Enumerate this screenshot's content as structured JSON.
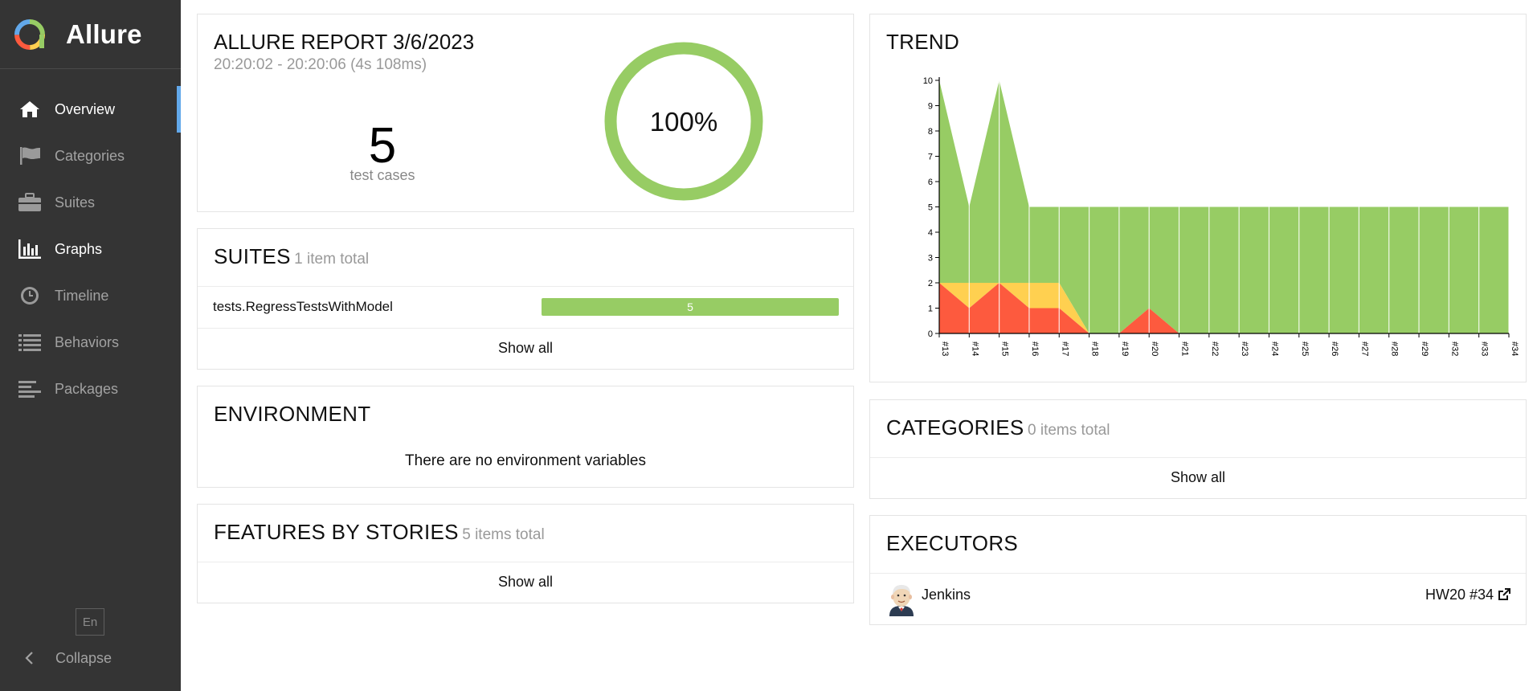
{
  "sidebar": {
    "brand": "Allure",
    "items": [
      {
        "label": "Overview",
        "icon": "home-icon",
        "active": true
      },
      {
        "label": "Categories",
        "icon": "flag-icon",
        "active": false
      },
      {
        "label": "Suites",
        "icon": "briefcase-icon",
        "active": false
      },
      {
        "label": "Graphs",
        "icon": "bar-chart-icon",
        "active": true
      },
      {
        "label": "Timeline",
        "icon": "clock-icon",
        "active": false
      },
      {
        "label": "Behaviors",
        "icon": "list-icon",
        "active": false
      },
      {
        "label": "Packages",
        "icon": "align-left-icon",
        "active": false
      }
    ],
    "language": "En",
    "collapse_label": "Collapse"
  },
  "summary": {
    "title": "ALLURE REPORT 3/6/2023",
    "time": "20:20:02 - 20:20:06 (4s 108ms)",
    "count": "5",
    "count_label": "test cases",
    "percent": "100%",
    "pass_fraction": 1.0
  },
  "suites": {
    "title": "SUITES",
    "subtitle": "1 item total",
    "rows": [
      {
        "name": "tests.RegressTestsWithModel",
        "passed": "5"
      }
    ],
    "show_all": "Show all"
  },
  "environment": {
    "title": "ENVIRONMENT",
    "empty": "There are no environment variables"
  },
  "features": {
    "title": "FEATURES BY STORIES",
    "subtitle": "5 items total",
    "show_all": "Show all"
  },
  "trend": {
    "title": "TREND"
  },
  "categories": {
    "title": "CATEGORIES",
    "subtitle": "0 items total",
    "show_all": "Show all"
  },
  "executors": {
    "title": "EXECUTORS",
    "name": "Jenkins",
    "build": "HW20 #34"
  },
  "colors": {
    "passed": "#97cc64",
    "failed": "#fd5a3e",
    "broken": "#ffd050",
    "sidebar": "#343434",
    "accent": "#62a8ea"
  },
  "chart_data": {
    "type": "area",
    "categories": [
      "#13",
      "#14",
      "#15",
      "#16",
      "#17",
      "#18",
      "#19",
      "#20",
      "#21",
      "#22",
      "#23",
      "#24",
      "#25",
      "#26",
      "#27",
      "#28",
      "#29",
      "#32",
      "#33",
      "#34"
    ],
    "series": [
      {
        "name": "failed",
        "values": [
          2,
          1,
          2,
          1,
          1,
          0,
          0,
          1,
          0,
          0,
          0,
          0,
          0,
          0,
          0,
          0,
          0,
          0,
          0,
          0
        ]
      },
      {
        "name": "broken",
        "values": [
          0,
          1,
          0,
          1,
          1,
          0,
          0,
          0,
          0,
          0,
          0,
          0,
          0,
          0,
          0,
          0,
          0,
          0,
          0,
          0
        ]
      },
      {
        "name": "passed",
        "values": [
          8,
          3,
          8,
          3,
          3,
          5,
          5,
          4,
          5,
          5,
          5,
          5,
          5,
          5,
          5,
          5,
          5,
          5,
          5,
          5
        ]
      }
    ],
    "ylim": [
      0,
      10
    ],
    "yticks": [
      "0",
      "1",
      "2",
      "3",
      "4",
      "5",
      "6",
      "7",
      "8",
      "9",
      "10"
    ],
    "stacked": true
  }
}
